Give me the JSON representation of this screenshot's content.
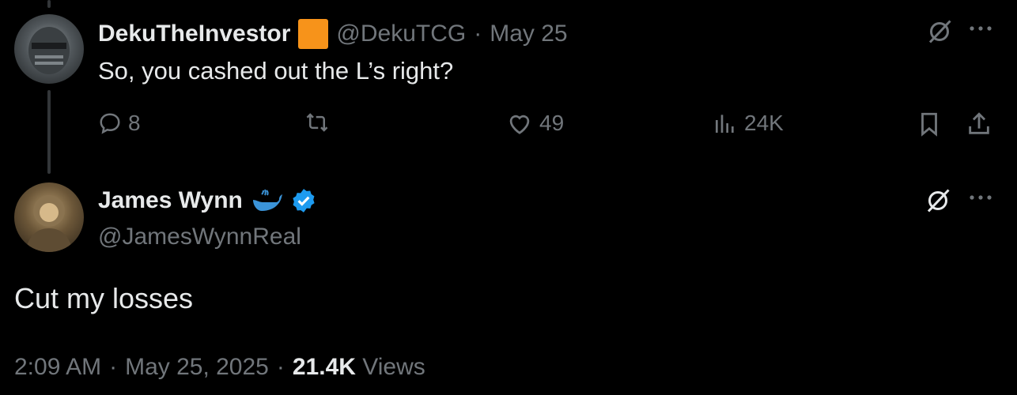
{
  "reply_tweet": {
    "display_name": "DekuTheInvestor",
    "handle": "@DekuTCG",
    "separator": "·",
    "date": "May 25",
    "text": "So, you cashed out the L’s right?",
    "badge_color": "#f7931a",
    "actions": {
      "replies": "8",
      "retweets": "",
      "likes": "49",
      "views": "24K"
    }
  },
  "main_tweet": {
    "display_name": "James Wynn",
    "handle": "@JamesWynnReal",
    "text": "Cut my losses",
    "time": "2:09 AM",
    "sep1": "·",
    "date": "May 25, 2025",
    "sep2": "·",
    "views_count": "21.4K",
    "views_label": "Views",
    "verified_color": "#1d9bf0"
  },
  "colors": {
    "background": "#000000",
    "text_primary": "#e7e9ea",
    "text_secondary": "#71767b",
    "thread_line": "#333639"
  }
}
